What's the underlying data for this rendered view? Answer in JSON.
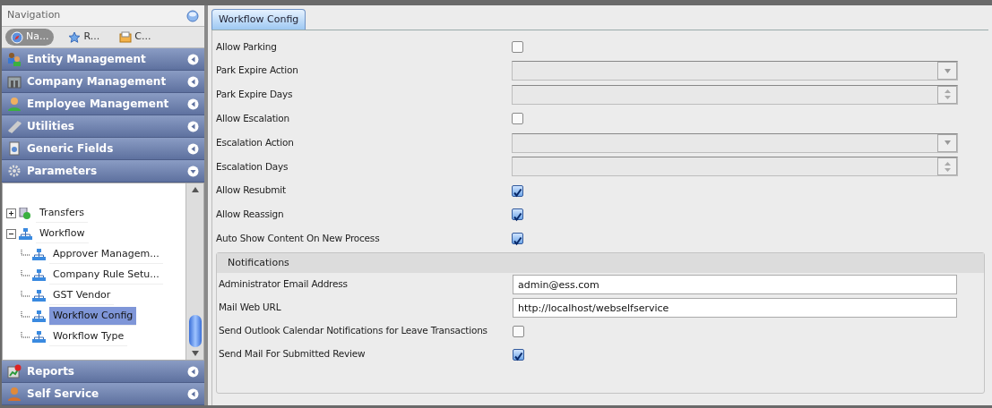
{
  "navigation": {
    "title": "Navigation",
    "buttons": [
      {
        "label": "Na...",
        "selected": true
      },
      {
        "label": "R...",
        "selected": false
      },
      {
        "label": "C...",
        "selected": false
      }
    ],
    "sections": [
      {
        "label": "Entity Management",
        "expanded": false
      },
      {
        "label": "Company Management",
        "expanded": false
      },
      {
        "label": "Employee Management",
        "expanded": false
      },
      {
        "label": "Utilities",
        "expanded": false
      },
      {
        "label": "Generic Fields",
        "expanded": false
      },
      {
        "label": "Parameters",
        "expanded": true,
        "tree": [
          {
            "label": "Transfers",
            "expanded": false,
            "selected": false
          },
          {
            "label": "Workflow",
            "expanded": true,
            "selected": false,
            "children": [
              {
                "label": "Approver Managem...",
                "selected": false
              },
              {
                "label": "Company Rule Setu...",
                "selected": false
              },
              {
                "label": "GST Vendor",
                "selected": false
              },
              {
                "label": "Workflow Config",
                "selected": true
              },
              {
                "label": "Workflow Type",
                "selected": false
              }
            ]
          }
        ]
      },
      {
        "label": "Reports",
        "expanded": false
      },
      {
        "label": "Self Service",
        "expanded": false
      }
    ]
  },
  "tabs": [
    {
      "label": "Workflow Config",
      "selected": true
    }
  ],
  "fields": [
    {
      "label": "Allow Parking",
      "kind": "checkbox",
      "checked": false
    },
    {
      "label": "Park Expire Action",
      "kind": "select"
    },
    {
      "label": "Park Expire Days",
      "kind": "spinner"
    },
    {
      "label": "Allow Escalation",
      "kind": "checkbox",
      "checked": false
    },
    {
      "label": "Escalation Action",
      "kind": "select"
    },
    {
      "label": "Escalation Days",
      "kind": "spinner"
    },
    {
      "label": "Allow Resubmit",
      "kind": "checkbox",
      "checked": true
    },
    {
      "label": "Allow Reassign",
      "kind": "checkbox",
      "checked": true
    },
    {
      "label": "Auto Show Content On New Process",
      "kind": "checkbox",
      "checked": true
    }
  ],
  "notifications": {
    "title": "Notifications",
    "fields": [
      {
        "label": "Administrator Email Address",
        "kind": "text",
        "value": "admin@ess.com"
      },
      {
        "label": "Mail Web URL",
        "kind": "text",
        "value": "http://localhost/webselfservice"
      },
      {
        "label": "Send Outlook Calendar Notifications for Leave Transactions",
        "kind": "checkbox",
        "checked": false
      },
      {
        "label": "Send Mail For Submitted Review",
        "kind": "checkbox",
        "checked": true
      }
    ]
  }
}
